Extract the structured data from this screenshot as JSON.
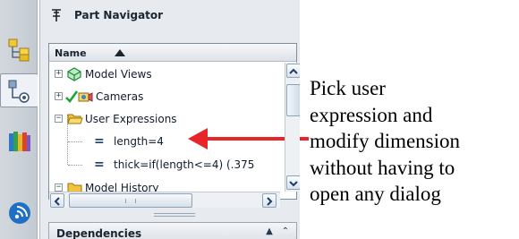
{
  "resource_bar": {
    "items": [
      {
        "icon": "assembly-navigator-icon"
      },
      {
        "icon": "part-navigator-icon",
        "active": true
      },
      {
        "icon": "reuse-library-icon"
      },
      {
        "icon": "roles-icon"
      }
    ]
  },
  "navigator": {
    "title": "Part Navigator",
    "column_header": "Name",
    "sort_indicator": "▲",
    "tree": [
      {
        "label": "Model Views",
        "expander": "+",
        "icon": "model-views-icon"
      },
      {
        "label": "Cameras",
        "expander": "+",
        "icon": "cameras-icon",
        "status": "check-icon"
      },
      {
        "label": "User Expressions",
        "expander": "−",
        "icon": "open-folder-icon"
      },
      {
        "label": "length=4",
        "icon": "expression-equals-icon"
      },
      {
        "label": "thick=if(length<=4) (.375",
        "icon": "expression-equals-icon"
      },
      {
        "label": "Model History",
        "expander": "−",
        "icon": "folder-icon"
      }
    ],
    "dependencies_title": "Dependencies"
  },
  "annotation": {
    "lines": [
      "Pick user",
      "expression and",
      "modify dimension",
      "without having to",
      "open any dialog"
    ]
  },
  "colors": {
    "arrow": "#e8262a",
    "selection_text": "#0f1c2c"
  }
}
